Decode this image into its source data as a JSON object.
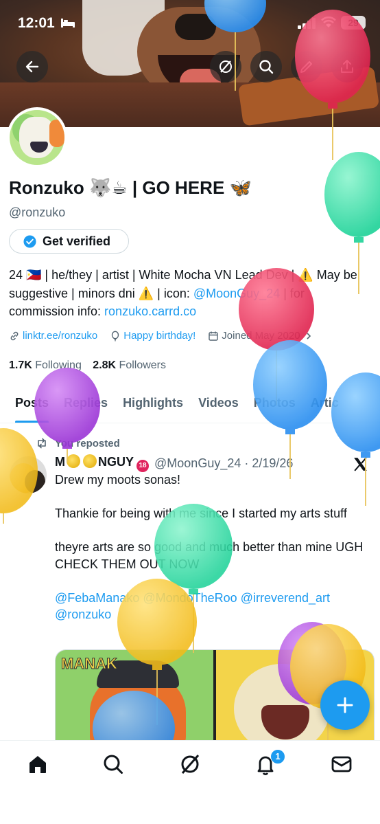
{
  "status_bar": {
    "time": "12:01",
    "battery": "29"
  },
  "profile": {
    "name": "Ronzuko 🐺☕ | GO HERE 🦋",
    "handle": "@ronzuko",
    "get_verified": "Get verified",
    "bio": {
      "part1": "24 🇵🇭 | he/they | artist | White Mocha VN Lead Dev | ⚠️ May be suggestive | minors dni ⚠️ | icon: ",
      "mention": "@MoonGuy_24",
      "part2": " | for commission info: ",
      "link": "ronzuko.carrd.co"
    },
    "meta": {
      "link": "linktr.ee/ronzuko",
      "birthday": "Happy birthday!",
      "joined": "Joined May 2020"
    },
    "following_count": "1.7K",
    "following_label": "Following",
    "followers_count": "2.8K",
    "followers_label": "Followers"
  },
  "tabs": [
    "Posts",
    "Replies",
    "Highlights",
    "Videos",
    "Photos",
    "Artic"
  ],
  "post": {
    "repost_label": "You reposted",
    "author_name_start": "M",
    "author_name_end": "NGUY",
    "author_badge": "18",
    "author_handle_date": "@MoonGuy_24 · 2/19/26",
    "lines": [
      "Drew my moots sonas!",
      "Thankie for being with me since I started my arts stuff",
      "theyre arts are so good and much better than mine UGH CHECK THEM OUT NOW"
    ],
    "mentions": "@FebaManako @MondoTheRoo @irreverend_art @ronzuko",
    "media_vertical_text": "MANAK"
  },
  "nav": {
    "notification_count": "1"
  },
  "colors": {
    "accent": "#1d9bf0",
    "text": "#0f1419",
    "muted": "#536471"
  },
  "icons": [
    "back-arrow-icon",
    "grok-icon",
    "search-icon",
    "edit-icon",
    "share-icon",
    "verified-check-icon",
    "link-icon",
    "balloon-icon",
    "calendar-icon",
    "repost-icon",
    "x-logo-icon",
    "plus-icon",
    "home-icon",
    "notifications-icon",
    "messages-icon"
  ]
}
